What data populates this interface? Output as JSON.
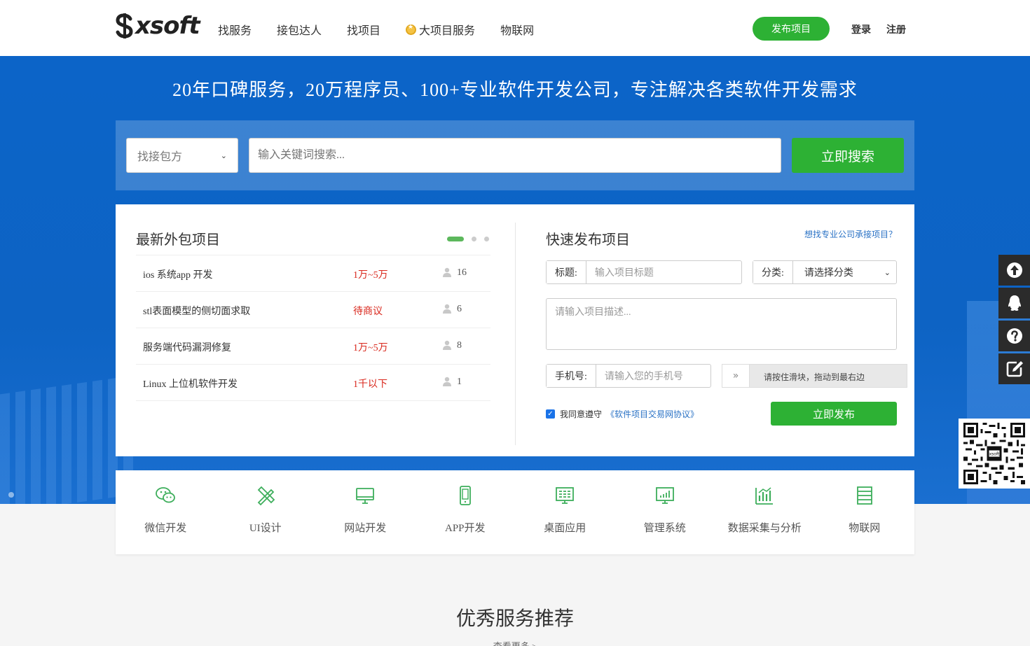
{
  "header": {
    "logo_text": "xsoft",
    "nav": [
      "找服务",
      "接包达人",
      "找项目",
      "大项目服务",
      "物联网"
    ],
    "publish_label": "发布项目",
    "login_label": "登录",
    "register_label": "注册"
  },
  "banner": {
    "title": "20年口碑服务，20万程序员、100+专业软件开发公司，专注解决各类软件开发需求"
  },
  "search": {
    "type_selected": "找接包方",
    "placeholder": "输入关键词搜索...",
    "button": "立即搜索"
  },
  "latest": {
    "title": "最新外包项目",
    "projects": [
      {
        "name": "ios 系统app 开发",
        "price": "1万~5万",
        "count": "16"
      },
      {
        "name": "stl表面模型的侧切面求取",
        "price": "待商议",
        "count": "6"
      },
      {
        "name": "服务端代码漏洞修复",
        "price": "1万~5万",
        "count": "8"
      },
      {
        "name": "Linux 上位机软件开发",
        "price": "1千以下",
        "count": "1"
      }
    ]
  },
  "quick_publish": {
    "title": "快速发布项目",
    "company_link": "想找专业公司承接项目？",
    "title_label": "标题:",
    "title_placeholder": "输入项目标题",
    "category_label": "分类:",
    "category_selected": "请选择分类",
    "desc_placeholder": "请输入项目描述...",
    "phone_label": "手机号:",
    "phone_placeholder": "请输入您的手机号",
    "slider_text": "请按住滑块，拖动到最右边",
    "agree_text": "我同意遵守",
    "agree_link": "《软件项目交易网协议》",
    "agree_checked": true,
    "submit": "立即发布"
  },
  "categories": [
    {
      "label": "微信开发",
      "icon": "wechat-icon"
    },
    {
      "label": "UI设计",
      "icon": "design-tools-icon"
    },
    {
      "label": "网站开发",
      "icon": "monitor-icon"
    },
    {
      "label": "APP开发",
      "icon": "phone-icon"
    },
    {
      "label": "桌面应用",
      "icon": "desktop-grid-icon"
    },
    {
      "label": "管理系统",
      "icon": "chart-monitor-icon"
    },
    {
      "label": "数据采集与分析",
      "icon": "bar-chart-icon"
    },
    {
      "label": "物联网",
      "icon": "list-icon"
    }
  ],
  "recommend": {
    "title": "优秀服务推荐",
    "more": "查看更多 >"
  },
  "side_tools": [
    "arrow-up-icon",
    "qq-icon",
    "help-icon",
    "edit-icon"
  ],
  "colors": {
    "brand_green": "#2db134",
    "banner_blue": "#0c64c8",
    "price_red": "#d9271c",
    "link_blue": "#2a72c5"
  }
}
